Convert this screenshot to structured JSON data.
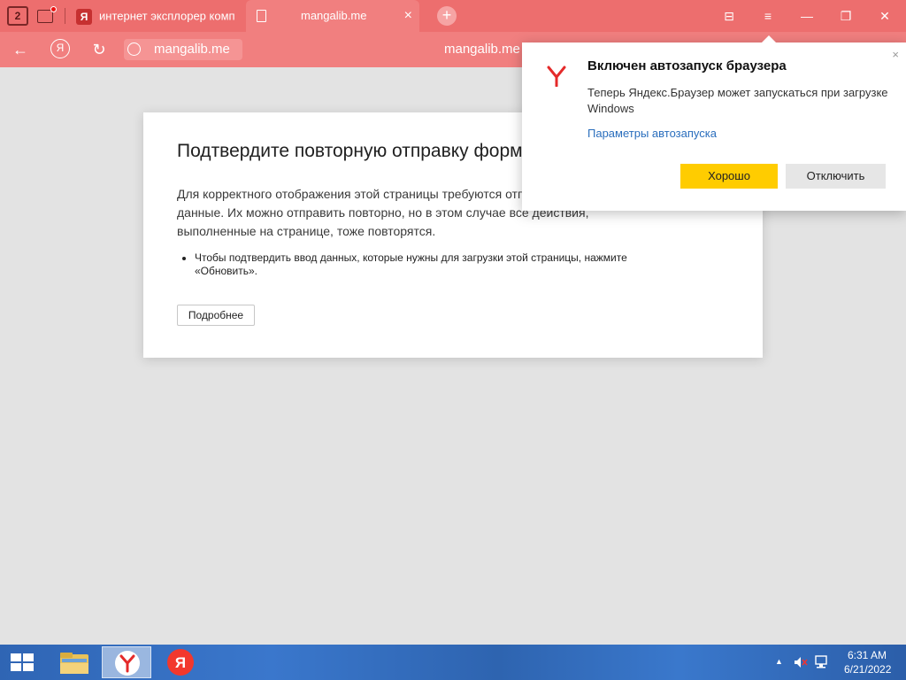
{
  "titlebar": {
    "tab_count": "2",
    "tabs": [
      {
        "label": "интернет эксплорер комп",
        "favicon": "Я",
        "active": false
      },
      {
        "label": "mangalib.me",
        "active": true
      }
    ],
    "close_tab_glyph": "×",
    "new_tab_glyph": "+",
    "window_buttons": {
      "bookmarks": "⊟",
      "menu": "≡",
      "minimize": "—",
      "restore": "❐",
      "close": "✕"
    }
  },
  "addressbar": {
    "back_glyph": "←",
    "yandex_glyph": "Я",
    "reload_glyph": "↻",
    "url": "mangalib.me",
    "page_title": "mangalib.me"
  },
  "dialog": {
    "title": "Подтвердите повторную отправку формы",
    "description": "Для корректного отображения этой страницы требуются отправленные ранее данные. Их можно отправить повторно, но в этом случае все действия, выполненные на странице, тоже повторятся.",
    "bullet": "Чтобы подтвердить ввод данных, которые нужны для загрузки этой страницы, нажмите «Обновить».",
    "more_button": "Подробнее"
  },
  "notification": {
    "title": "Включен автозапуск браузера",
    "text": "Теперь Яндекс.Браузер может запускаться при загрузке Windows",
    "link": "Параметры автозапуска",
    "close_glyph": "×",
    "ok_button": "Хорошо",
    "disable_button": "Отключить"
  },
  "taskbar": {
    "time": "6:31 AM",
    "date": "6/21/2022",
    "tray_up_glyph": "▲",
    "apps": [
      {
        "name": "file-explorer"
      },
      {
        "name": "yandex-browser",
        "active": true,
        "glyph": "Y"
      },
      {
        "name": "yandex",
        "glyph": "Я"
      }
    ]
  },
  "colors": {
    "titlebar": "#ed6e6e",
    "addressbar": "#f17f7f",
    "ok_button": "#ffcc00",
    "link": "#2a6ebd",
    "taskbar": "#2f65b4"
  }
}
